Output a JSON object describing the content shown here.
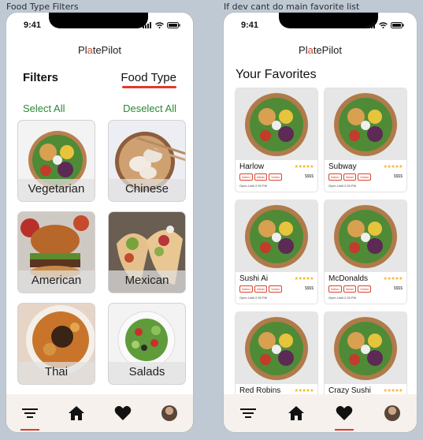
{
  "frame_labels": {
    "left": "Food Type Filters",
    "right": "If dev cant do main favorite list"
  },
  "status": {
    "time": "9:41"
  },
  "brand": {
    "pre": "Pl",
    "accent": "a",
    "post": "tePilot"
  },
  "filters": {
    "tab_filters": "Filters",
    "tab_food_type": "Food Type",
    "select_all": "Select All",
    "deselect_all": "Deselect All",
    "categories": [
      "Vegetarian",
      "Chinese",
      "American",
      "Mexican",
      "Thai",
      "Salads"
    ]
  },
  "favorites": {
    "title": "Your Favorites",
    "cards": [
      {
        "name": "Harlow",
        "price": "$$$$",
        "open": "Open Until 2:30 PM",
        "tags": [
          "Italian",
          "Italian",
          "Italian"
        ]
      },
      {
        "name": "Subway",
        "price": "$$$$",
        "open": "Open Until 2:30 PM",
        "tags": [
          "Italian",
          "Italian",
          "Italian"
        ]
      },
      {
        "name": "Sushi Ai",
        "price": "$$$$",
        "open": "Open Until 2:30 PM",
        "tags": [
          "Italian",
          "Italian",
          "Italian"
        ]
      },
      {
        "name": "McDonalds",
        "price": "$$$$",
        "open": "Open Until 2:30 PM",
        "tags": [
          "Italian",
          "Italian",
          "Italian"
        ]
      },
      {
        "name": "Red Robins",
        "price": "",
        "open": "",
        "tags": []
      },
      {
        "name": "Crazy Sushi",
        "price": "",
        "open": "",
        "tags": []
      }
    ],
    "stars": "★★★★★"
  },
  "nav": [
    "filters-icon",
    "home-icon",
    "heart-icon",
    "profile-avatar"
  ],
  "colors": {
    "accent": "#e03b2b",
    "green": "#2a8a35",
    "star": "#f2b21b"
  }
}
